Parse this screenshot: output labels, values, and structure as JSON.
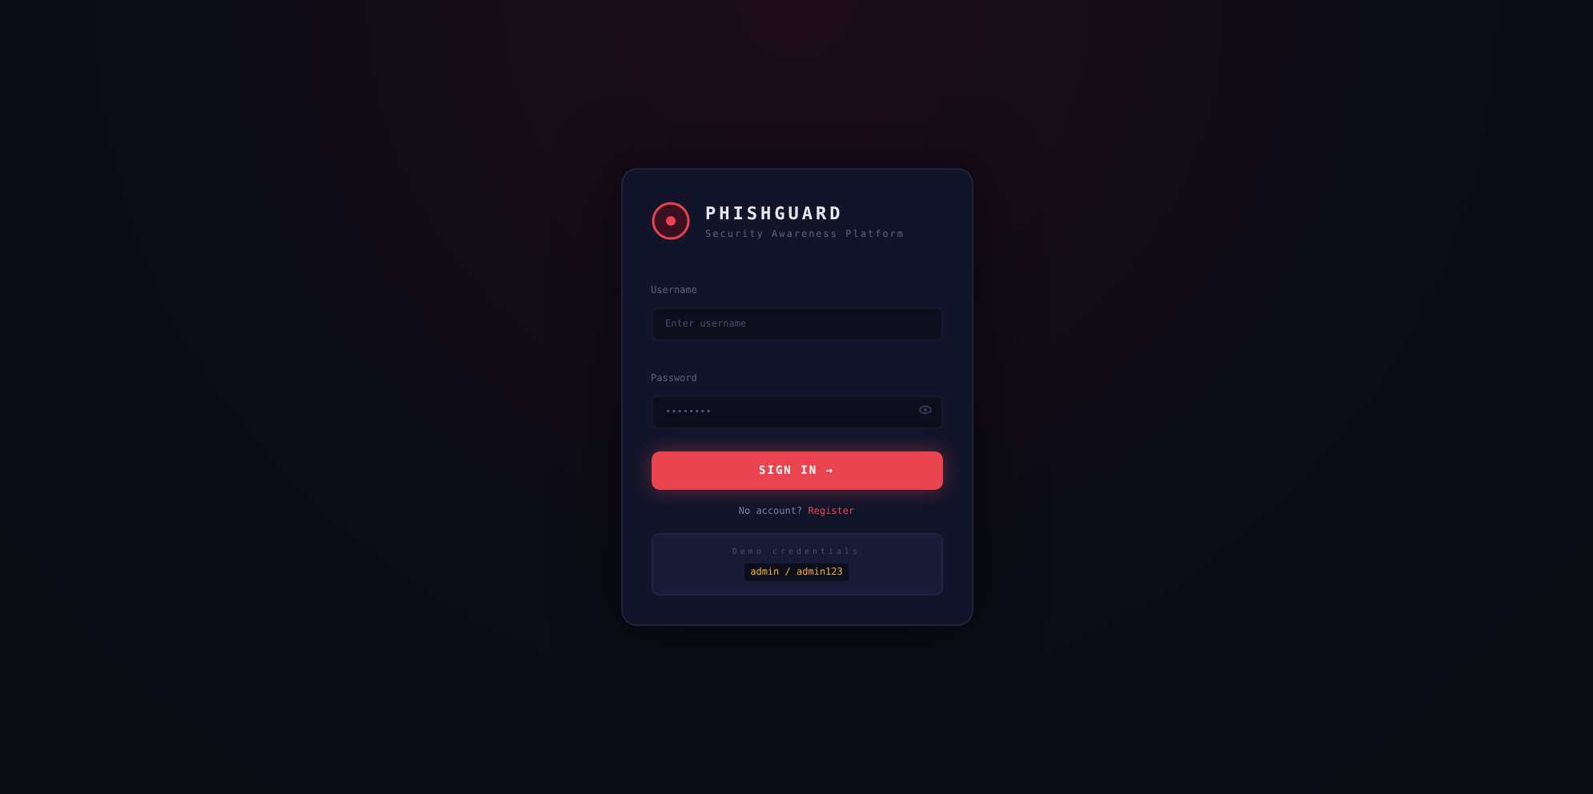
{
  "brand": {
    "name": "PHISHGUARD",
    "tagline": "Security Awareness Platform"
  },
  "fields": [
    {
      "label": "Username",
      "placeholder": "Enter username",
      "kind": "text"
    },
    {
      "label": "Password",
      "placeholder": "••••••••",
      "kind": "password"
    }
  ],
  "submit": "SIGN IN →",
  "register": {
    "prompt": "No account?",
    "link": "Register"
  },
  "demo": {
    "title": "Demo credentials",
    "value": "admin / admin123"
  }
}
